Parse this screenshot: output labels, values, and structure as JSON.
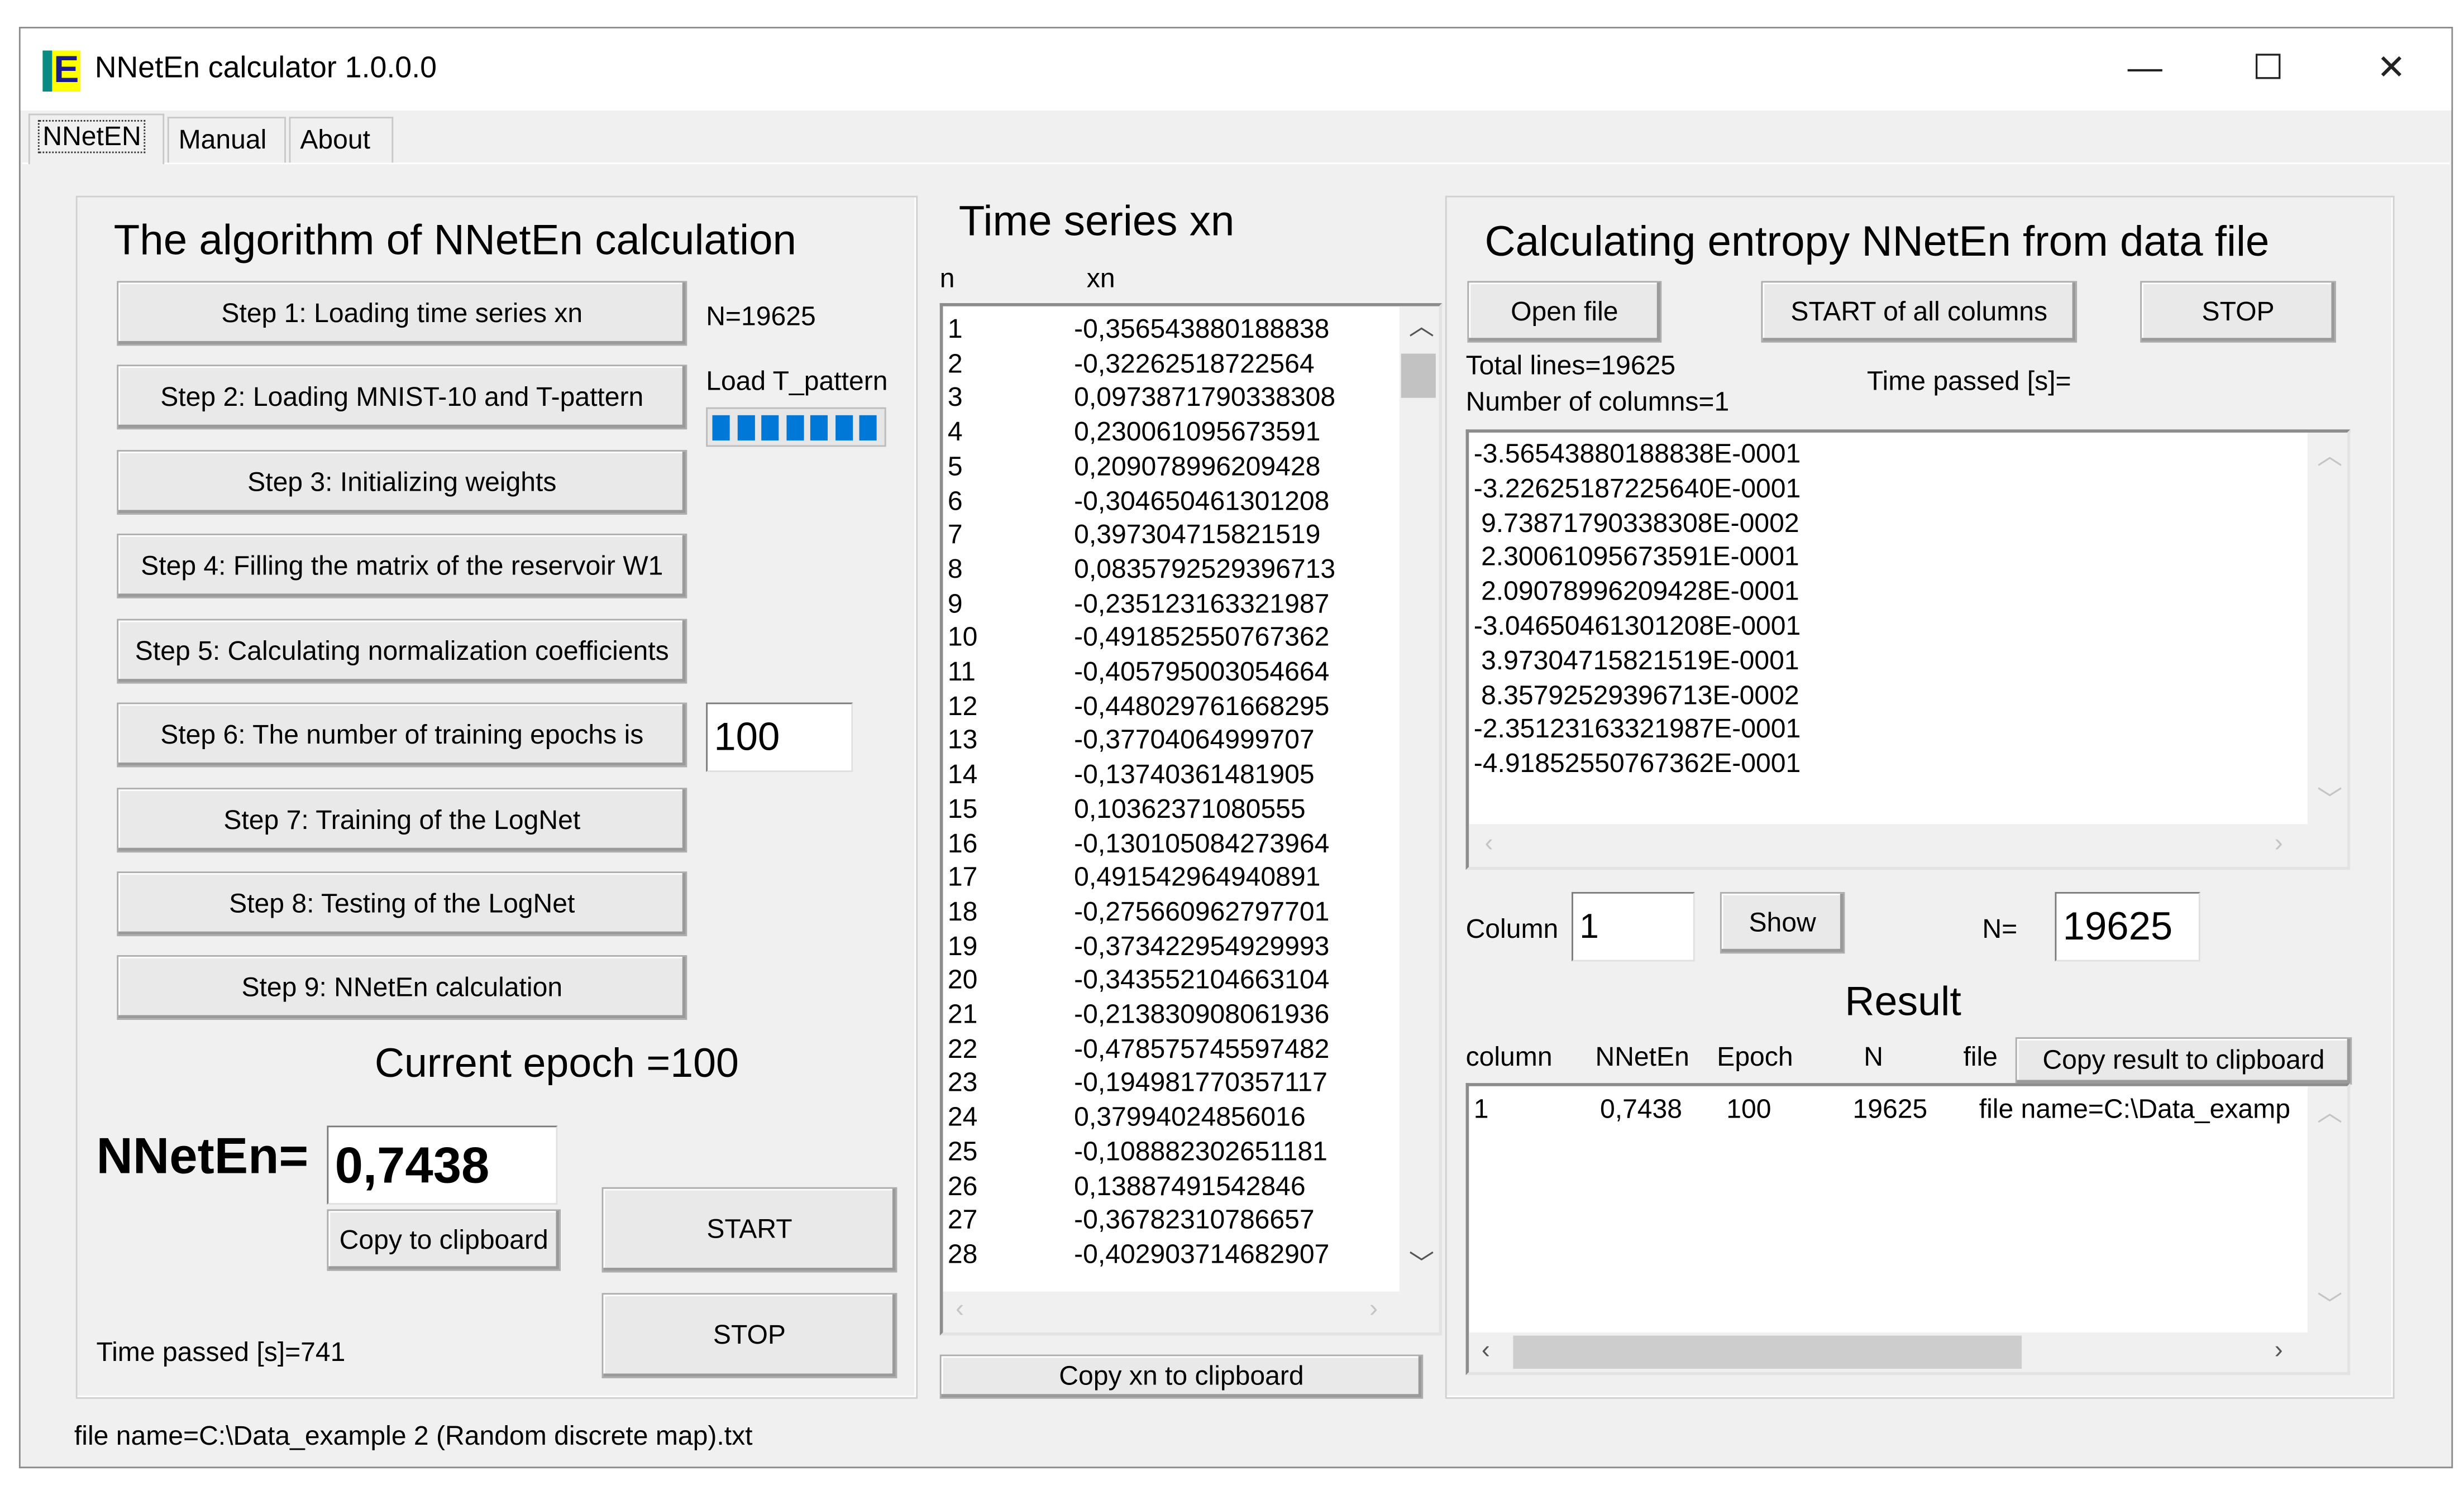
{
  "window": {
    "title": "NNetEn calculator 1.0.0.0",
    "minimize": "—",
    "maximize": "☐",
    "close": "✕"
  },
  "tabs": [
    {
      "label": "NNetEN",
      "active": true
    },
    {
      "label": "Manual"
    },
    {
      "label": "About"
    }
  ],
  "algorithm": {
    "title": "The algorithm of NNetEn calculation",
    "steps": [
      "Step 1: Loading time series xn",
      "Step 2: Loading MNIST-10 and T-pattern",
      "Step 3: Initializing weights",
      "Step 4: Filling the matrix of the reservoir W1",
      "Step 5: Calculating normalization coefficients",
      "Step 6: The number of training epochs is",
      "Step 7: Training of the LogNet",
      "Step 8: Testing of the LogNet",
      "Step 9: NNetEn calculation"
    ],
    "n_label": "N=19625",
    "load_label": "Load T_pattern",
    "load_progress_percent": 100,
    "epochs_value": "100",
    "current_epoch": "Current epoch =100",
    "nneten_label": "NNetEn=",
    "nneten_value": "0,7438",
    "copy_button": "Copy to clipboard",
    "start_button": "START",
    "stop_button": "STOP",
    "time_passed": "Time passed [s]=741"
  },
  "series": {
    "title": "Time series xn",
    "col_n": "n",
    "col_xn": "xn",
    "rows": [
      [
        "1",
        "-0,356543880188838"
      ],
      [
        "2",
        "-0,32262518722564"
      ],
      [
        "3",
        "0,0973871790338308"
      ],
      [
        "4",
        "0,230061095673591"
      ],
      [
        "5",
        "0,209078996209428"
      ],
      [
        "6",
        "-0,304650461301208"
      ],
      [
        "7",
        "0,397304715821519"
      ],
      [
        "8",
        "0,0835792529396713"
      ],
      [
        "9",
        "-0,235123163321987"
      ],
      [
        "10",
        "-0,491852550767362"
      ],
      [
        "11",
        "-0,405795003054664"
      ],
      [
        "12",
        "-0,448029761668295"
      ],
      [
        "13",
        "-0,37704064999707"
      ],
      [
        "14",
        "-0,13740361481905"
      ],
      [
        "15",
        "0,10362371080555"
      ],
      [
        "16",
        "-0,130105084273964"
      ],
      [
        "17",
        "0,491542964940891"
      ],
      [
        "18",
        "-0,275660962797701"
      ],
      [
        "19",
        "-0,373422954929993"
      ],
      [
        "20",
        "-0,343552104663104"
      ],
      [
        "21",
        "-0,213830908061936"
      ],
      [
        "22",
        "-0,478575745597482"
      ],
      [
        "23",
        "-0,194981770357117"
      ],
      [
        "24",
        "0,37994024856016"
      ],
      [
        "25",
        "-0,108882302651181"
      ],
      [
        "26",
        "0,13887491542846"
      ],
      [
        "27",
        "-0,36782310786657"
      ],
      [
        "28",
        "-0,402903714682907"
      ]
    ],
    "copy_button": "Copy xn to clipboard"
  },
  "file_calc": {
    "title": "Calculating entropy NNetEn from data file",
    "open_button": "Open file",
    "start_all_button": "START of all columns",
    "stop_button": "STOP",
    "total_lines": "Total lines=19625",
    "num_columns": "Number of columns=1",
    "time_passed": "Time passed [s]=",
    "data_lines": [
      "-3.56543880188838E-0001",
      "-3.22625187225640E-0001",
      " 9.73871790338308E-0002",
      " 2.30061095673591E-0001",
      " 2.09078996209428E-0001",
      "-3.04650461301208E-0001",
      " 3.97304715821519E-0001",
      " 8.35792529396713E-0002",
      "-2.35123163321987E-0001",
      "-4.91852550767362E-0001"
    ],
    "column_label": "Column",
    "column_value": "1",
    "show_button": "Show",
    "n_label": "N=",
    "n_value": "19625",
    "result_title": "Result",
    "result_headers": [
      "column",
      "NNetEn",
      "Epoch",
      "N",
      "file"
    ],
    "copy_result_button": "Copy result to clipboard",
    "result_rows": [
      [
        "1",
        "0,7438",
        "100",
        "19625",
        "file name=C:\\Data_examp"
      ]
    ]
  },
  "status": {
    "file_name": "file name=C:\\Data_example 2 (Random discrete map).txt"
  }
}
